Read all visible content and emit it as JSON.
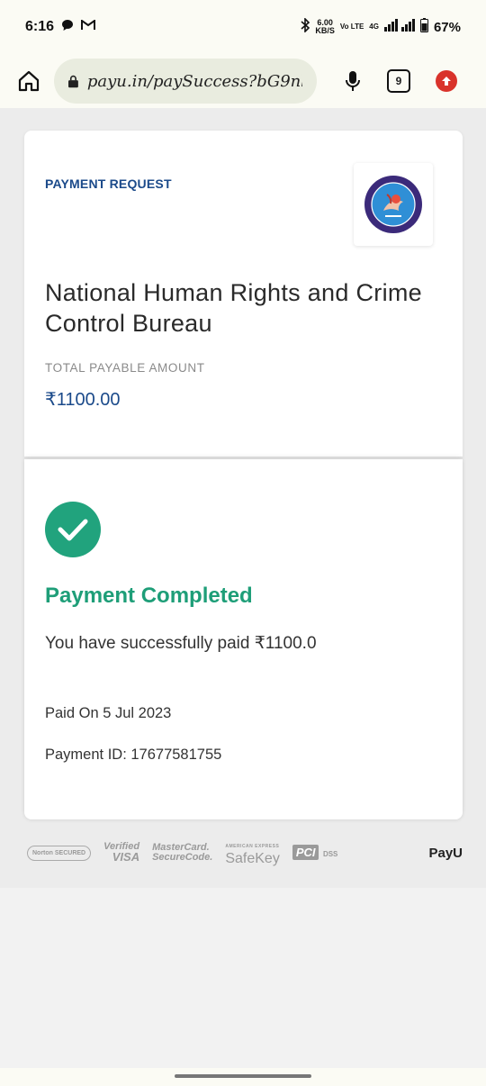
{
  "status_bar": {
    "time": "6:16",
    "net_speed_value": "6.00",
    "net_speed_unit": "KB/S",
    "volte_label": "Vo LTE",
    "network_label": "4G",
    "battery": "67%"
  },
  "browser": {
    "url": "payu.in/paySuccess?bG9nbzl",
    "tab_count": "9"
  },
  "card": {
    "request_label": "PAYMENT REQUEST",
    "org_name": "National Human Rights and Crime Control Bureau",
    "amount_label": "TOTAL PAYABLE AMOUNT",
    "amount": "₹1100.00"
  },
  "result": {
    "title": "Payment Completed",
    "message": "You have successfully paid ₹1100.0",
    "paid_on": "Paid On 5 Jul 2023",
    "payment_id": "Payment ID: 17677581755"
  },
  "badges": {
    "norton": "Norton SECURED",
    "verified_line1": "Verified",
    "verified_line2": "VISA",
    "mastercard_line1": "MasterCard.",
    "mastercard_line2": "SecureCode.",
    "safekey_small": "AMERICAN EXPRESS",
    "safekey": "SafeKey",
    "pci": "PCI",
    "dss": "DSS",
    "payu": "PayU"
  },
  "colors": {
    "brand_blue": "#1b4a8a",
    "success_green": "#1e9e78",
    "update_red": "#d9332b"
  }
}
